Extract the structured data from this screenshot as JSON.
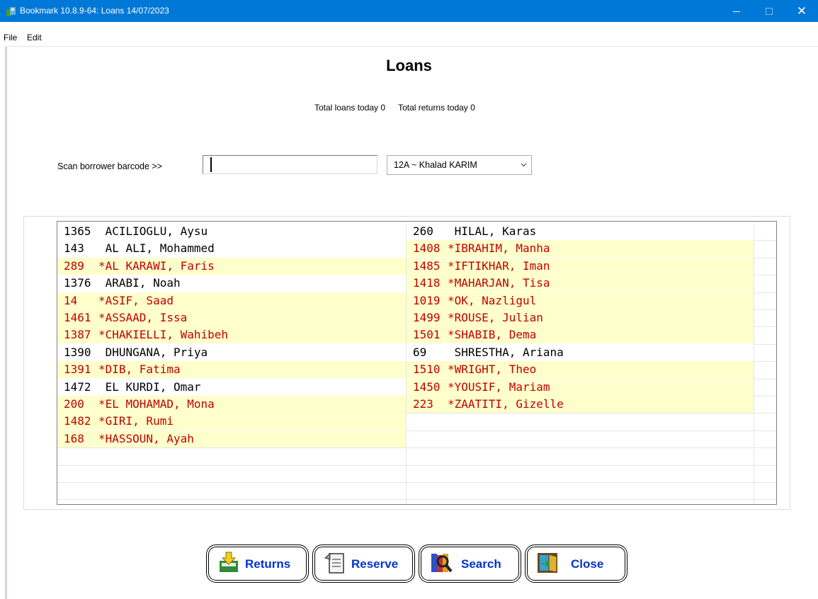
{
  "window": {
    "title": "Bookmark 10.8.9-64: Loans 14/07/2023",
    "minimize_label": "—",
    "close_label": "✕"
  },
  "menu": {
    "file": "File",
    "edit": "Edit"
  },
  "page": {
    "heading": "Loans",
    "totals": {
      "loans": "Total loans today 0",
      "returns": "Total returns today 0"
    }
  },
  "scan": {
    "label": "Scan borrower barcode >>",
    "value": "",
    "class_select": "12A ~ Khalad KARIM"
  },
  "borrowers": {
    "left": [
      {
        "id": "1365",
        "name": " ACILIOGLU, Aysu",
        "pending": false
      },
      {
        "id": "143",
        "name": " AL ALI, Mohammed",
        "pending": false
      },
      {
        "id": "289",
        "name": "*AL KARAWI, Faris",
        "pending": true
      },
      {
        "id": "1376",
        "name": " ARABI, Noah",
        "pending": false
      },
      {
        "id": "14",
        "name": "*ASIF, Saad",
        "pending": true
      },
      {
        "id": "1461",
        "name": "*ASSAAD, Issa",
        "pending": true
      },
      {
        "id": "1387",
        "name": "*CHAKIELLI, Wahibeh",
        "pending": true
      },
      {
        "id": "1390",
        "name": " DHUNGANA, Priya",
        "pending": false
      },
      {
        "id": "1391",
        "name": "*DIB, Fatima",
        "pending": true
      },
      {
        "id": "1472",
        "name": " EL KURDI, Omar",
        "pending": false
      },
      {
        "id": "200",
        "name": "*EL MOHAMAD, Mona",
        "pending": true
      },
      {
        "id": "1482",
        "name": "*GIRI, Rumi",
        "pending": true
      },
      {
        "id": "168",
        "name": "*HASSOUN, Ayah",
        "pending": true
      }
    ],
    "right": [
      {
        "id": "260",
        "name": " HILAL, Karas",
        "pending": false
      },
      {
        "id": "1408",
        "name": "*IBRAHIM, Manha",
        "pending": true
      },
      {
        "id": "1485",
        "name": "*IFTIKHAR, Iman",
        "pending": true
      },
      {
        "id": "1418",
        "name": "*MAHARJAN, Tisa",
        "pending": true
      },
      {
        "id": "1019",
        "name": "*OK, Nazligul",
        "pending": true
      },
      {
        "id": "1499",
        "name": "*ROUSE, Julian",
        "pending": true
      },
      {
        "id": "1501",
        "name": "*SHABIB, Dema",
        "pending": true
      },
      {
        "id": "69",
        "name": " SHRESTHA, Ariana",
        "pending": false
      },
      {
        "id": "1510",
        "name": "*WRIGHT, Theo",
        "pending": true
      },
      {
        "id": "1450",
        "name": "*YOUSIF, Mariam",
        "pending": true
      },
      {
        "id": "223",
        "name": "*ZAATITI, Gizelle",
        "pending": true
      }
    ]
  },
  "buttons": {
    "returns": "Returns",
    "reserve": "Reserve",
    "search": "Search",
    "close": "Close"
  },
  "colors": {
    "titlebar": "#0078d7",
    "pending_bg": "#ffffcc",
    "pending_text": "#c00000",
    "button_text": "#0033cc"
  },
  "icons": [
    "app-icon",
    "chevron-down-icon",
    "returns-icon",
    "reserve-icon",
    "search-icon",
    "close-door-icon"
  ]
}
